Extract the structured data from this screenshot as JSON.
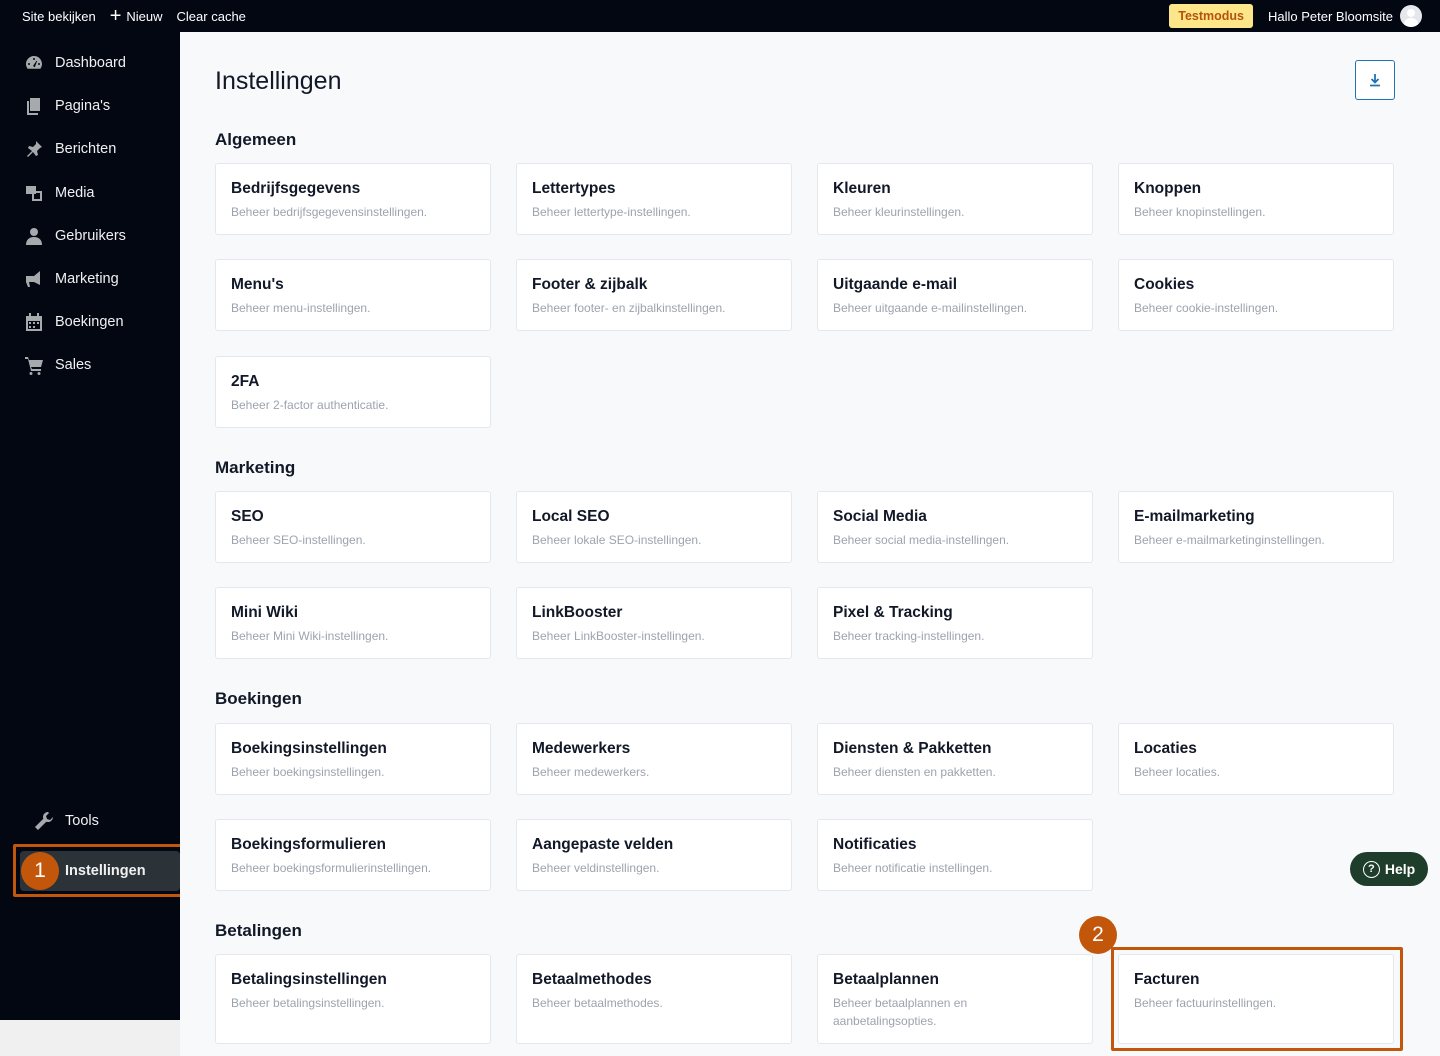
{
  "topbar": {
    "view_site": "Site bekijken",
    "new_label": "Nieuw",
    "clear_cache": "Clear cache",
    "test_badge": "Testmodus",
    "greeting": "Hallo Peter Bloomsite"
  },
  "sidebar": {
    "items": [
      {
        "label": "Dashboard",
        "icon": "dashboard-icon"
      },
      {
        "label": "Pagina's",
        "icon": "pages-icon"
      },
      {
        "label": "Berichten",
        "icon": "pin-icon"
      },
      {
        "label": "Media",
        "icon": "media-icon"
      },
      {
        "label": "Gebruikers",
        "icon": "user-icon"
      },
      {
        "label": "Marketing",
        "icon": "megaphone-icon"
      },
      {
        "label": "Boekingen",
        "icon": "calendar-icon"
      },
      {
        "label": "Sales",
        "icon": "cart-icon"
      }
    ],
    "tools": "Tools",
    "settings": "Instellingen"
  },
  "annotations": {
    "step1": "1",
    "step2": "2",
    "accent": "#c2570c"
  },
  "page": {
    "title": "Instellingen"
  },
  "sections": {
    "algemeen": {
      "title": "Algemeen",
      "cards": [
        {
          "title": "Bedrijfsgegevens",
          "desc": "Beheer bedrijfsgegevensinstellingen."
        },
        {
          "title": "Lettertypes",
          "desc": "Beheer lettertype-instellingen."
        },
        {
          "title": "Kleuren",
          "desc": "Beheer kleurinstellingen."
        },
        {
          "title": "Knoppen",
          "desc": "Beheer knopinstellingen."
        },
        {
          "title": "Menu's",
          "desc": "Beheer menu-instellingen."
        },
        {
          "title": "Footer & zijbalk",
          "desc": "Beheer footer- en zijbalkinstellingen."
        },
        {
          "title": "Uitgaande e-mail",
          "desc": "Beheer uitgaande e-mailinstellingen."
        },
        {
          "title": "Cookies",
          "desc": "Beheer cookie-instellingen."
        },
        {
          "title": "2FA",
          "desc": "Beheer 2-factor authenticatie."
        }
      ]
    },
    "marketing": {
      "title": "Marketing",
      "cards": [
        {
          "title": "SEO",
          "desc": "Beheer SEO-instellingen."
        },
        {
          "title": "Local SEO",
          "desc": "Beheer lokale SEO-instellingen."
        },
        {
          "title": "Social Media",
          "desc": "Beheer social media-instellingen."
        },
        {
          "title": "E-mailmarketing",
          "desc": "Beheer e-mailmarketinginstellingen."
        },
        {
          "title": "Mini Wiki",
          "desc": "Beheer Mini Wiki-instellingen."
        },
        {
          "title": "LinkBooster",
          "desc": "Beheer LinkBooster-instellingen."
        },
        {
          "title": "Pixel & Tracking",
          "desc": "Beheer tracking-instellingen."
        }
      ]
    },
    "boekingen": {
      "title": "Boekingen",
      "cards": [
        {
          "title": "Boekingsinstellingen",
          "desc": "Beheer boekingsinstellingen."
        },
        {
          "title": "Medewerkers",
          "desc": "Beheer medewerkers."
        },
        {
          "title": "Diensten & Pakketten",
          "desc": "Beheer diensten en pakketten."
        },
        {
          "title": "Locaties",
          "desc": "Beheer locaties."
        },
        {
          "title": "Boekingsformulieren",
          "desc": "Beheer boekingsformulierinstellingen."
        },
        {
          "title": "Aangepaste velden",
          "desc": "Beheer veldinstellingen."
        },
        {
          "title": "Notificaties",
          "desc": "Beheer notificatie instellingen."
        }
      ]
    },
    "betalingen": {
      "title": "Betalingen",
      "cards": [
        {
          "title": "Betalingsinstellingen",
          "desc": "Beheer betalingsinstellingen."
        },
        {
          "title": "Betaalmethodes",
          "desc": "Beheer betaalmethodes."
        },
        {
          "title": "Betaalplannen",
          "desc": "Beheer betaalplannen en aanbetalingsopties."
        },
        {
          "title": "Facturen",
          "desc": "Beheer factuurinstellingen."
        }
      ]
    }
  },
  "help": {
    "label": "Help"
  }
}
